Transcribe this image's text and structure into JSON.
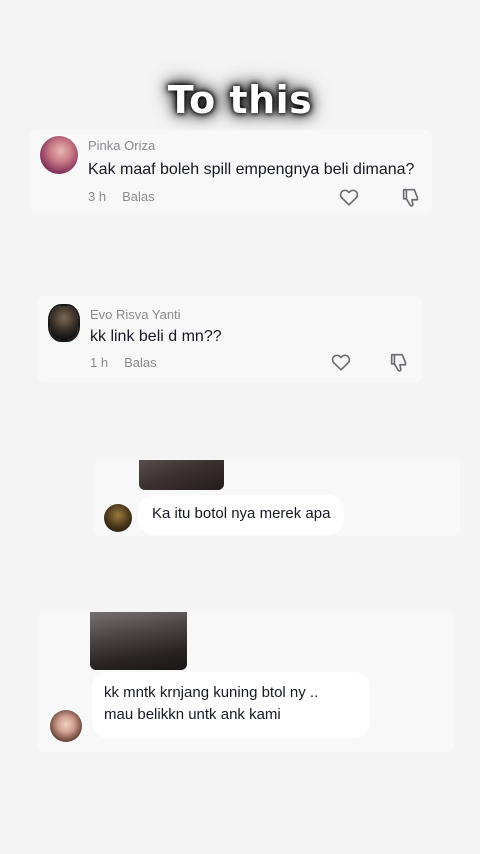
{
  "overlay": {
    "title": "To this"
  },
  "comments": [
    {
      "username": "Pinka Oriza",
      "text": "Kak maaf boleh spill empengnya beli dimana?",
      "time": "3 h",
      "reply_label": "Balas"
    },
    {
      "username": "Evo Risva Yanti",
      "text": "kk link beli d mn??",
      "time": "1 h",
      "reply_label": "Balas"
    }
  ],
  "replies": [
    {
      "text": "Ka itu botol nya merek apa"
    },
    {
      "line1": "kk mntk krnjang kuning btol ny ..",
      "line2": "mau belikkn untk ank kami"
    }
  ],
  "icons": {
    "like": "heart-icon",
    "dislike": "thumbs-down-icon"
  },
  "colors": {
    "background": "#f4f4f5",
    "muted_text": "#8a8b91",
    "primary_text": "#161823"
  }
}
